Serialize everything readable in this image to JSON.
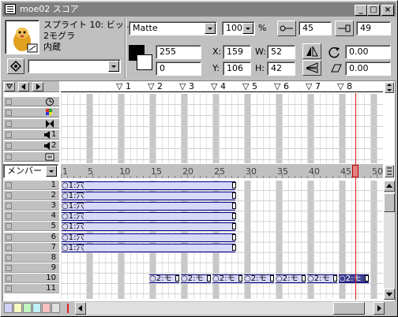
{
  "window": {
    "title": "moe02 スコア"
  },
  "titlebar_buttons": {
    "minimize": "_",
    "maximize": "□",
    "close": "×"
  },
  "sprite_info": {
    "line1": "スプライト 10: ビッ...",
    "line2": "2モグラ",
    "line3": "内蔵"
  },
  "ink": {
    "value": "Matte"
  },
  "blend": {
    "value": "100",
    "unit": "%"
  },
  "fore_color": {
    "value": "255"
  },
  "back_color": {
    "value": "0"
  },
  "position": {
    "x_label": "X:",
    "x": "159",
    "y_label": "Y:",
    "y": "106"
  },
  "size": {
    "w_label": "W:",
    "w": "52",
    "h_label": "H:",
    "h": "42"
  },
  "start_frame": {
    "value": "45"
  },
  "end_frame": {
    "value": "49"
  },
  "rotation": {
    "value": "0.00"
  },
  "skew": {
    "value": "0.00"
  },
  "markers": [
    "1",
    "2",
    "3",
    "4",
    "5",
    "6",
    "7",
    "8"
  ],
  "frame_ruler": [
    "1",
    "5",
    "10",
    "15",
    "20",
    "25",
    "30",
    "35",
    "40",
    "45",
    "50"
  ],
  "display_mode": {
    "value": "メンバー"
  },
  "special_channels": [
    "tempo",
    "palette",
    "transition",
    "sound-1",
    "sound-2",
    "script"
  ],
  "special_labels": {
    "sound1": "1",
    "sound2": "2"
  },
  "channel_numbers": [
    "1",
    "2",
    "3",
    "4",
    "5",
    "6",
    "7",
    "8",
    "9",
    "10",
    "11"
  ],
  "sprites": [
    {
      "channel": 1,
      "label": "○1:穴"
    },
    {
      "channel": 2,
      "label": "○1:穴"
    },
    {
      "channel": 3,
      "label": "○1:穴"
    },
    {
      "channel": 4,
      "label": "○1:穴"
    },
    {
      "channel": 5,
      "label": "○1:穴"
    },
    {
      "channel": 6,
      "label": "○1:穴"
    },
    {
      "channel": 7,
      "label": "○1:穴"
    }
  ],
  "row10_sprites": [
    "○2:モ",
    "○2:モ",
    "○2:モ",
    "○2:モ",
    "○2:モ",
    "○2:モ",
    "○2:モ"
  ],
  "colors": {
    "sprite_fill": "#d8d8f8",
    "sprite_border": "#000080",
    "selected_sprite": "#404090",
    "playhead": "#e02020",
    "title_bar": "#808080"
  }
}
